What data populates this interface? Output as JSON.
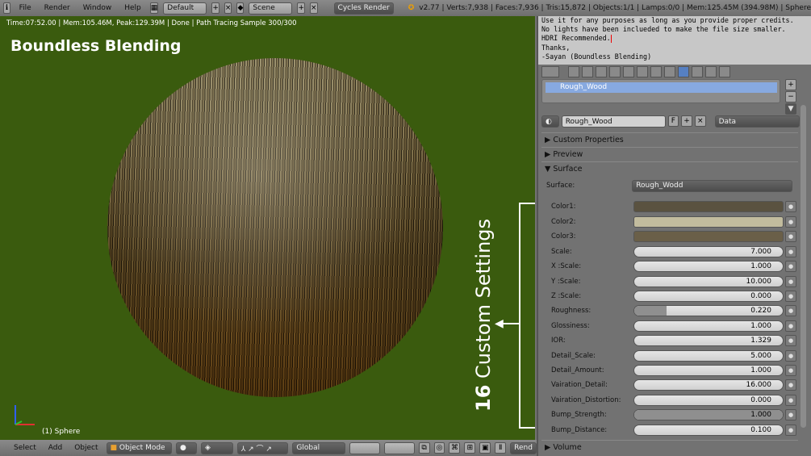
{
  "header": {
    "menus": [
      "File",
      "Render",
      "Window",
      "Help"
    ],
    "layout": "Default",
    "scene": "Scene",
    "engine": "Cycles Render",
    "stats": "v2.77 | Verts:7,938 | Faces:7,936 | Tris:15,872 | Objects:1/1 | Lamps:0/0 | Mem:125.45M (394.98M) | Sphere"
  },
  "viewport": {
    "info": "Time:07:52.00 | Mem:105.46M, Peak:129.39M | Done | Path Tracing Sample 300/300",
    "title": "Boundless Blending",
    "annotation_num": "16",
    "annotation_text": " Custom Settings",
    "object": "(1) Sphere"
  },
  "bottom": {
    "menus": [
      "Select",
      "Add",
      "Object"
    ],
    "mode": "Object Mode",
    "orientation": "Global",
    "render": "Rend"
  },
  "text_editor": {
    "lines": [
      "Use it for any purposes as long as you provide proper credits.",
      "No lights have been inclueded to make the file size smaller.",
      "HDRI Recommended.",
      "Thanks,",
      "-Sayan (Boundless Blending)"
    ]
  },
  "properties": {
    "slot": "Rough_Wood",
    "material": "Rough_Wood",
    "fake_user": "F",
    "link": "Data",
    "panels": {
      "custom": "Custom Properties",
      "preview": "Preview",
      "surface": "Surface",
      "volume": "Volume"
    },
    "surface_label": "Surface:",
    "surface_value": "Rough_Wodd",
    "colors": [
      {
        "label": "Color1:",
        "hex": "#5a5240"
      },
      {
        "label": "Color2:",
        "hex": "#c2bc9e"
      },
      {
        "label": "Color3:",
        "hex": "#6a5f48"
      }
    ],
    "fields": [
      {
        "label": "Scale:",
        "value": "7.000"
      },
      {
        "label": "X :Scale:",
        "value": "1.000"
      },
      {
        "label": "Y :Scale:",
        "value": "10.000"
      },
      {
        "label": "Z :Scale:",
        "value": "0.000"
      },
      {
        "label": "Roughness:",
        "value": "0.220",
        "fill": 0.22
      },
      {
        "label": "Glossiness:",
        "value": "1.000"
      },
      {
        "label": "IOR:",
        "value": "1.329"
      },
      {
        "label": "Detail_Scale:",
        "value": "5.000"
      },
      {
        "label": "Detail_Amount:",
        "value": "1.000"
      },
      {
        "label": "Vairation_Detail:",
        "value": "16.000"
      },
      {
        "label": "Vairation_Distortion:",
        "value": "0.000"
      },
      {
        "label": "Bump_Strength:",
        "value": "1.000",
        "fill": 1.0
      },
      {
        "label": "Bump_Distance:",
        "value": "0.100"
      }
    ]
  }
}
